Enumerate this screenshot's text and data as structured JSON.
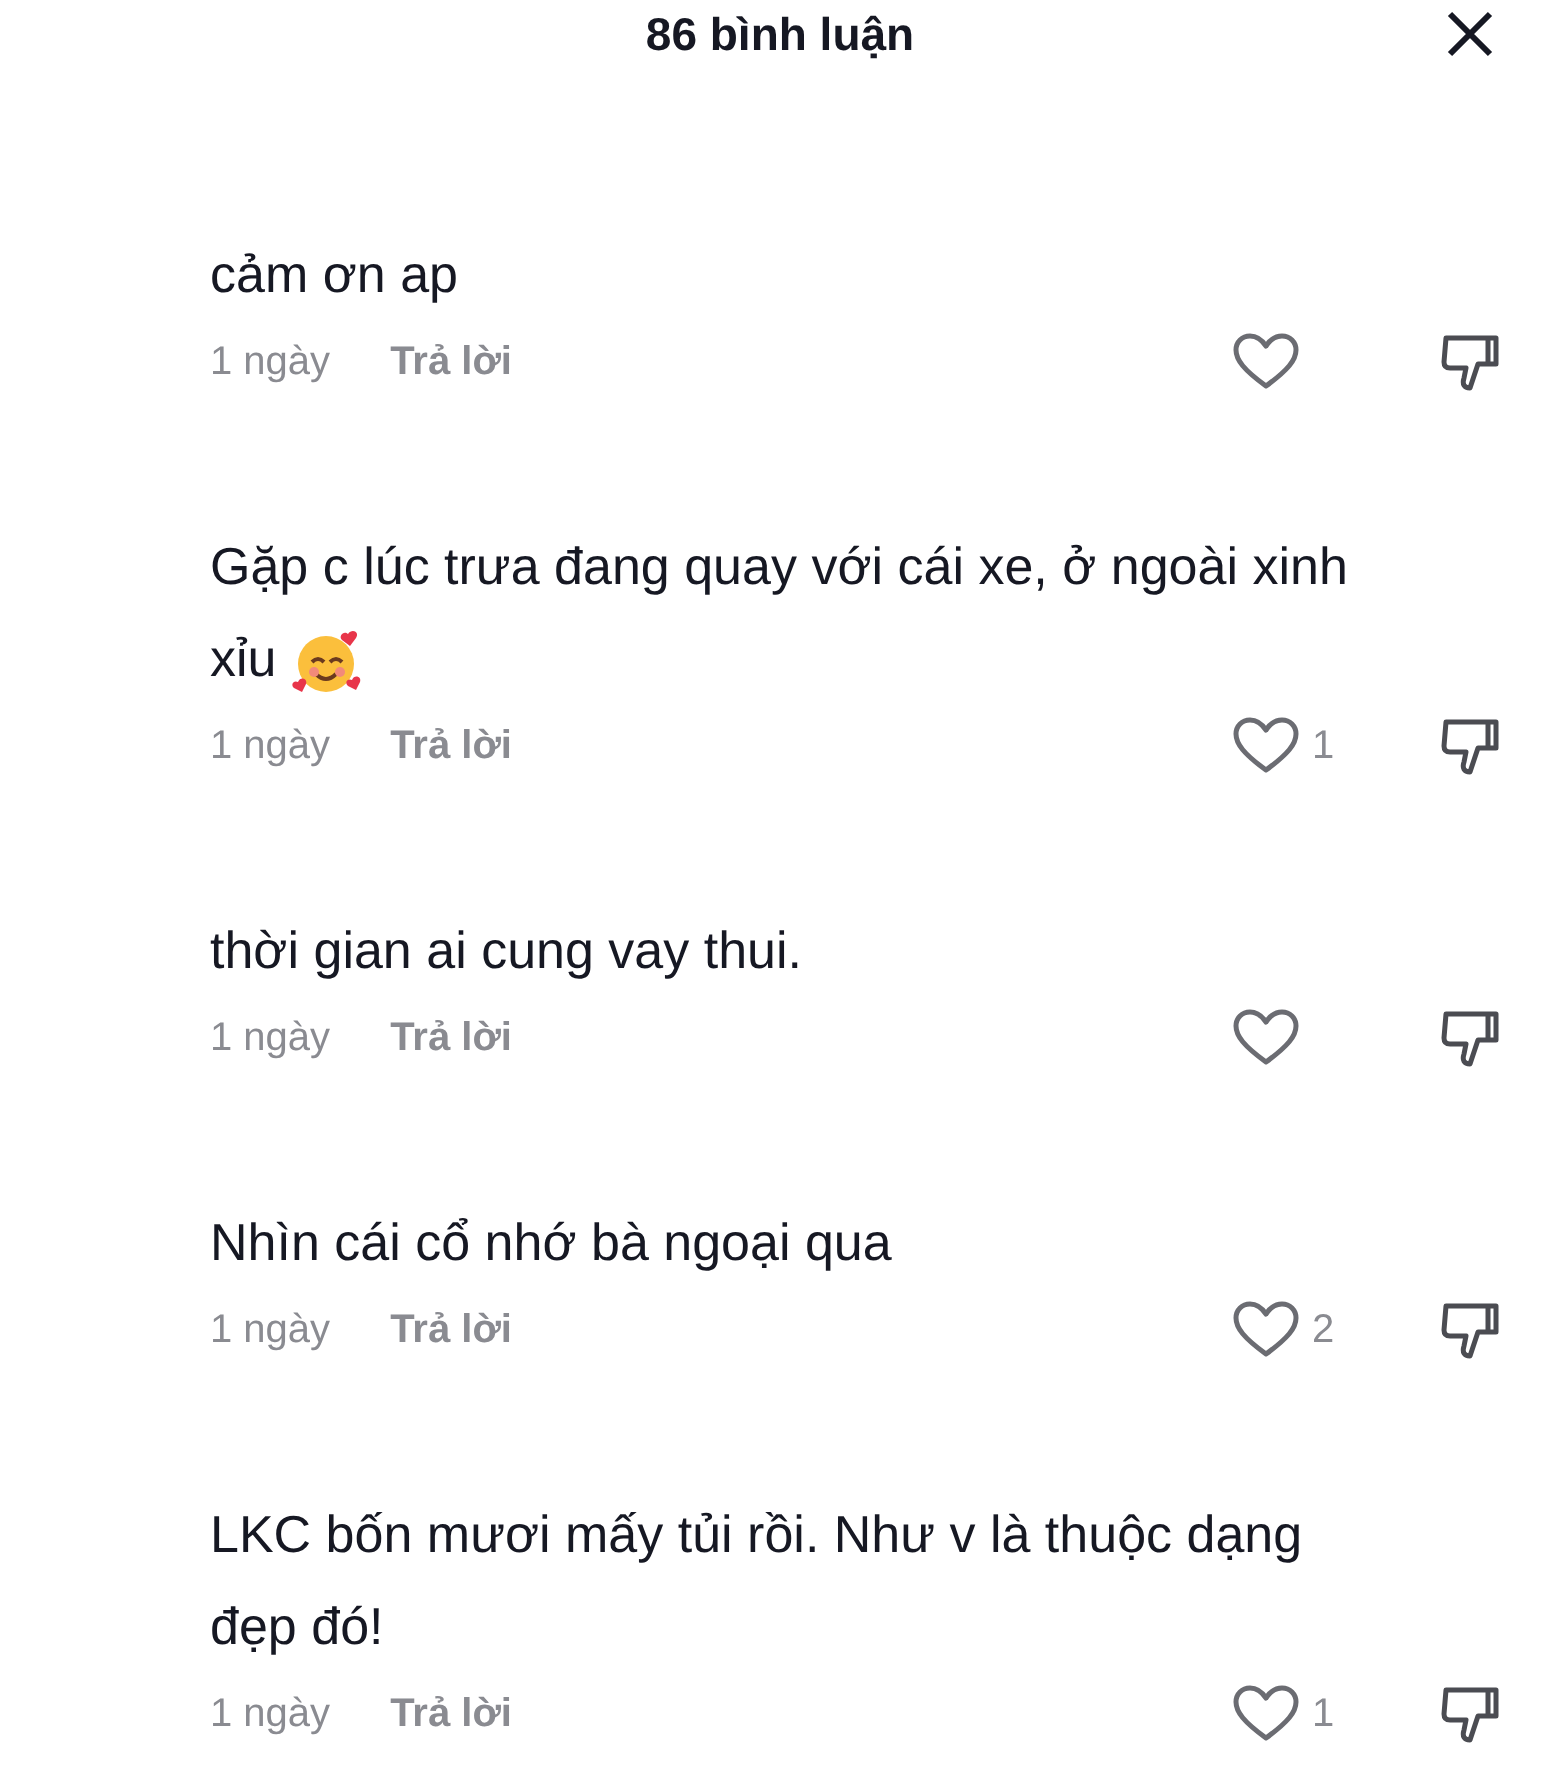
{
  "header": {
    "title": "86 bình luận"
  },
  "comments": [
    {
      "text": "cảm ơn ap",
      "emoji": false,
      "time": "1 ngày",
      "reply": "Trả lời"
    },
    {
      "text": "Gặp c lúc trưa đang quay với cái xe, ở ngoài xinh xỉu",
      "emoji": true,
      "time": "1 ngày",
      "reply": "Trả lời",
      "likes": "1"
    },
    {
      "text": "thời gian ai cung vay thui.",
      "emoji": false,
      "time": "1 ngày",
      "reply": "Trả lời"
    },
    {
      "text": "Nhìn cái cổ nhớ bà ngoại qua",
      "emoji": false,
      "time": "1 ngày",
      "reply": "Trả lời",
      "likes": "2"
    },
    {
      "text": "LKC bốn mươi mấy tủi rồi. Như v là thuộc dạng đẹp đó!",
      "emoji": false,
      "time": "1 ngày",
      "reply": "Trả lời",
      "likes": "1"
    }
  ]
}
